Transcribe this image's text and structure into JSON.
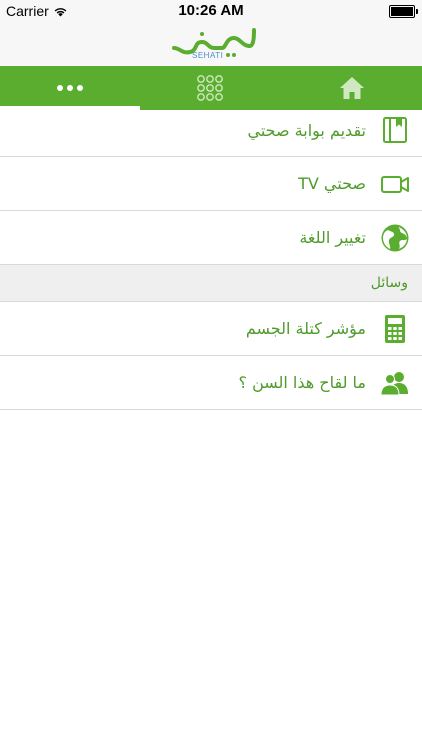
{
  "status_bar": {
    "carrier": "Carrier",
    "time": "10:26 AM",
    "battery_level": 1.0
  },
  "header": {
    "logo_text": "صحتي",
    "logo_subtext": "SEHATI",
    "logo_colors": {
      "primary": "#5aad2f",
      "secondary": "#4a8ec8"
    }
  },
  "tabbar": {
    "background": "#5aad2f",
    "tabs": [
      {
        "icon": "more-dots-icon",
        "selected": true
      },
      {
        "icon": "grid-icon",
        "selected": false
      },
      {
        "icon": "home-icon",
        "selected": false
      }
    ]
  },
  "menu": {
    "items": [
      {
        "label": "تقديم بوابة صحتي",
        "icon": "book-icon"
      },
      {
        "label": "صحتي TV",
        "icon": "video-camera-icon"
      },
      {
        "label": "تغيير اللغة",
        "icon": "globe-icon"
      }
    ],
    "section_title": "وسائل",
    "tools": [
      {
        "label": "مؤشر كتلة الجسم",
        "icon": "calculator-icon"
      },
      {
        "label": "ما لقاح هذا السن ؟",
        "icon": "people-icon"
      }
    ]
  },
  "colors": {
    "accent": "#5aad2f",
    "text_green": "#4d9b2a",
    "section_bg": "#efefef",
    "divider": "#d9d9d9"
  }
}
